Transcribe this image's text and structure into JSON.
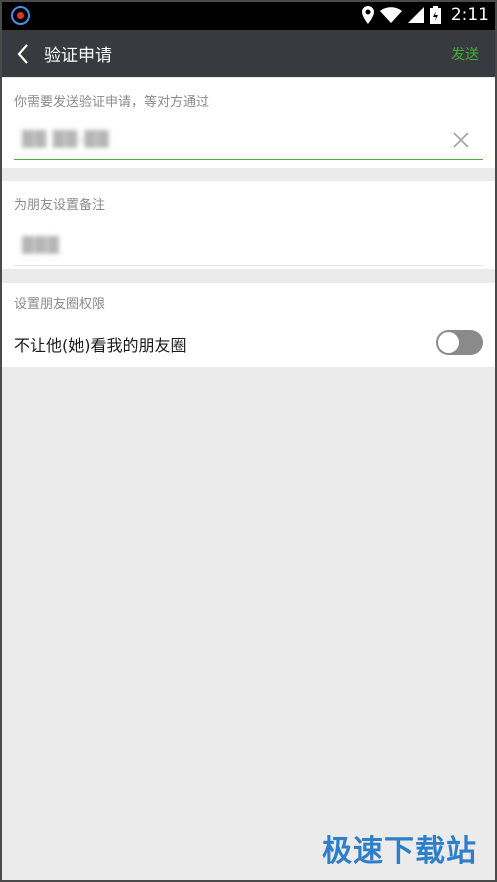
{
  "status_bar": {
    "time": "2:11",
    "icons": [
      "record-icon",
      "location-icon",
      "wifi-icon",
      "signal-icon",
      "battery-icon"
    ]
  },
  "header": {
    "title": "验证申请",
    "send_label": "发送",
    "accent_color": "#3cb034"
  },
  "verify_section": {
    "label": "你需要发送验证申请，等对方通过",
    "input_value": "██ ██-██"
  },
  "remark_section": {
    "label": "为朋友设置备注",
    "input_value": "███"
  },
  "moments_section": {
    "label": "设置朋友圈权限",
    "toggle_label": "不让他(她)看我的朋友圈",
    "toggle_on": false
  },
  "watermark": "极速下载站"
}
